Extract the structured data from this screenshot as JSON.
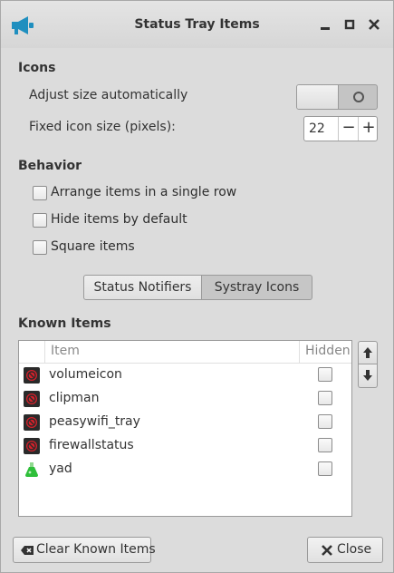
{
  "window": {
    "title": "Status Tray Items"
  },
  "icons_section": {
    "heading": "Icons",
    "adjust_label": "Adjust size automatically",
    "adjust_enabled": false,
    "fixed_label": "Fixed icon size (pixels):",
    "fixed_value": "22",
    "minus": "−",
    "plus": "+"
  },
  "behavior_section": {
    "heading": "Behavior",
    "options": [
      {
        "label": "Arrange items in a single row",
        "checked": false
      },
      {
        "label": "Hide items by default",
        "checked": false
      },
      {
        "label": "Square items",
        "checked": false
      }
    ]
  },
  "tabs": [
    {
      "label": "Status Notifiers",
      "selected": false
    },
    {
      "label": "Systray Icons",
      "selected": true
    }
  ],
  "known_items": {
    "heading": "Known Items",
    "col_item": "Item",
    "col_hidden": "Hidden",
    "rows": [
      {
        "name": "volumeicon",
        "icon": "blocked-icon",
        "hidden": false
      },
      {
        "name": "clipman",
        "icon": "blocked-icon",
        "hidden": false
      },
      {
        "name": "peasywifi_tray",
        "icon": "blocked-icon",
        "hidden": false
      },
      {
        "name": "firewallstatus",
        "icon": "blocked-icon",
        "hidden": false
      },
      {
        "name": "yad",
        "icon": "flask-icon",
        "hidden": false
      }
    ]
  },
  "buttons": {
    "clear": "Clear Known Items",
    "close": "Close"
  },
  "colors": {
    "accent": "#1f8fbf",
    "blocked_red": "#d6202a",
    "flask_green": "#2fbf3a"
  }
}
